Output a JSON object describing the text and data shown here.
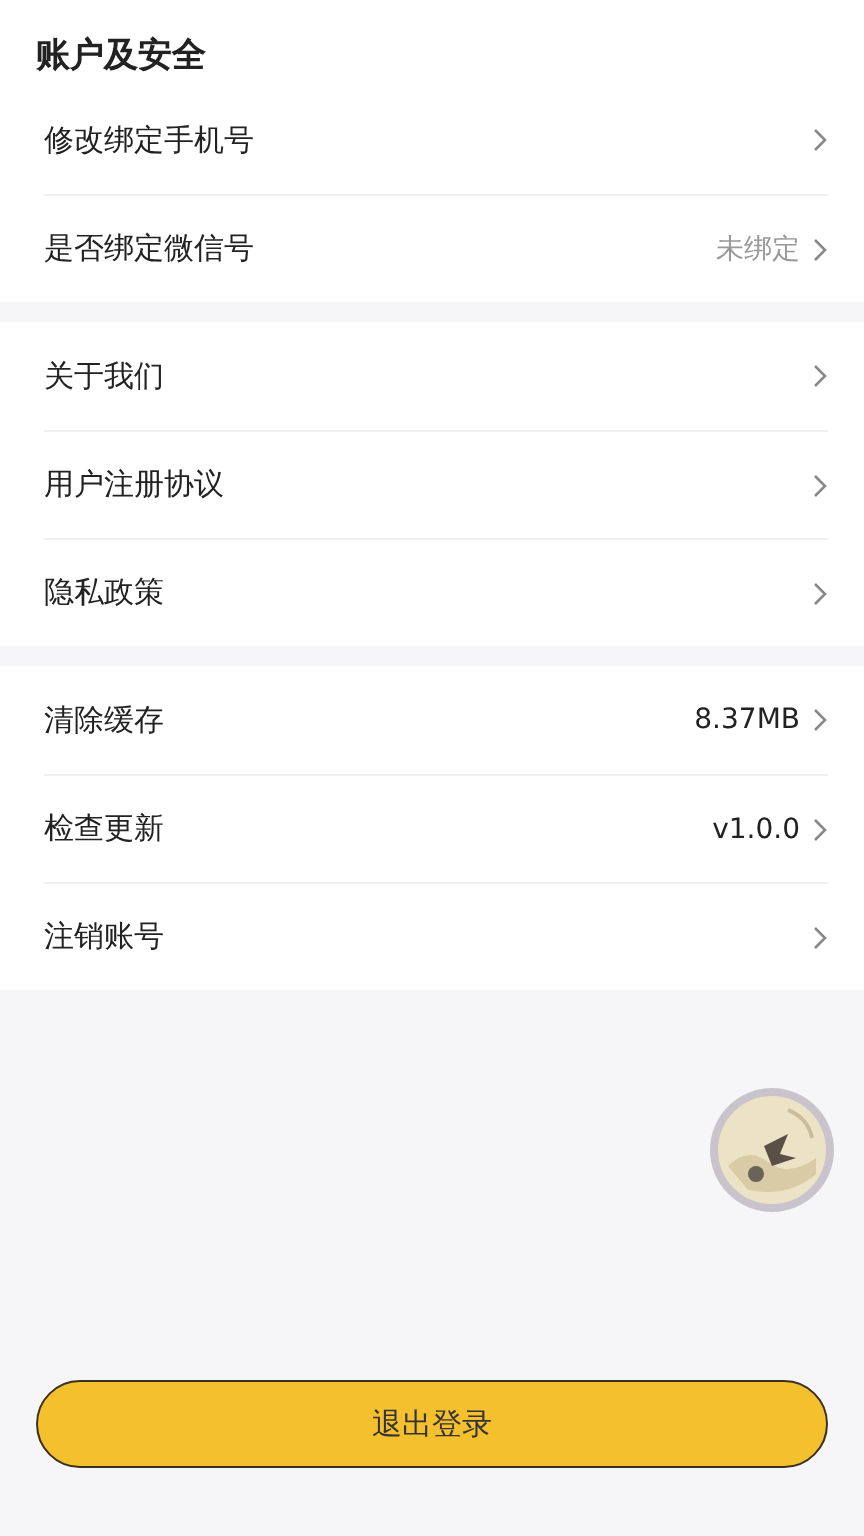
{
  "title": "账户及安全",
  "sections": [
    {
      "rows": [
        {
          "label": "修改绑定手机号"
        },
        {
          "label": "是否绑定微信号",
          "value": "未绑定",
          "value_muted": true
        }
      ]
    },
    {
      "rows": [
        {
          "label": "关于我们"
        },
        {
          "label": "用户注册协议"
        },
        {
          "label": "隐私政策"
        }
      ]
    },
    {
      "rows": [
        {
          "label": "清除缓存",
          "value": "8.37MB",
          "value_muted": false
        },
        {
          "label": "检查更新",
          "value": "v1.0.0",
          "value_muted": false
        },
        {
          "label": "注销账号"
        }
      ]
    }
  ],
  "logout_button": "退出登录"
}
